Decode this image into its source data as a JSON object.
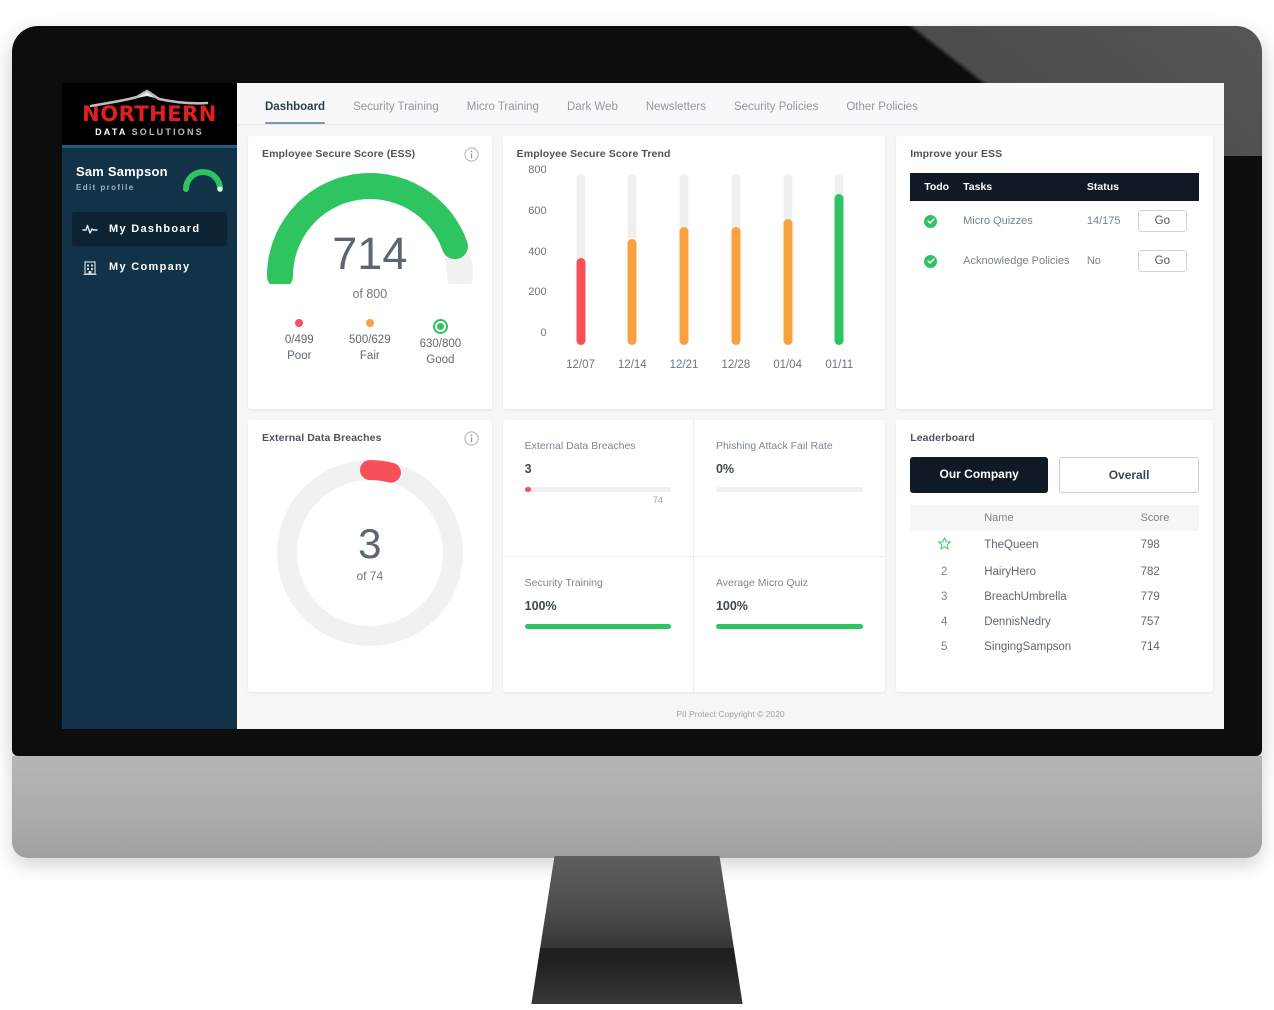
{
  "brand": {
    "name": "NORTHERN",
    "sub_data": "DATA",
    "sub_solutions": "SOLUTIONS"
  },
  "sidebar": {
    "user_name": "Sam Sampson",
    "edit_profile": "Edit profile",
    "items": [
      {
        "label": "My Dashboard",
        "icon": "pulse-icon",
        "active": true
      },
      {
        "label": "My Company",
        "icon": "building-icon",
        "active": false
      }
    ]
  },
  "tabs": [
    {
      "label": "Dashboard",
      "active": true
    },
    {
      "label": "Security Training",
      "active": false
    },
    {
      "label": "Micro Training",
      "active": false
    },
    {
      "label": "Dark Web",
      "active": false
    },
    {
      "label": "Newsletters",
      "active": false
    },
    {
      "label": "Security Policies",
      "active": false
    },
    {
      "label": "Other Policies",
      "active": false
    }
  ],
  "ess_card": {
    "title": "Employee Secure Score (ESS)",
    "value": "714",
    "of_label": "of 800",
    "legend": [
      {
        "range": "0/499",
        "label": "Poor",
        "color": "#f8505a"
      },
      {
        "range": "500/629",
        "label": "Fair",
        "color": "#f9a03f"
      },
      {
        "range": "630/800",
        "label": "Good",
        "color": "#2ec45f"
      }
    ]
  },
  "breaches_card": {
    "title": "External Data Breaches",
    "value": "3",
    "of_label": "of 74"
  },
  "improve_card": {
    "title": "Improve your ESS",
    "columns": [
      "Todo",
      "Tasks",
      "Status"
    ],
    "rows": [
      {
        "task": "Micro Quizzes",
        "status": "14/175",
        "action": "Go"
      },
      {
        "task": "Acknowledge Policies",
        "status": "No",
        "action": "Go"
      }
    ]
  },
  "metrics": [
    {
      "label": "External Data Breaches",
      "value": "3",
      "pct": 4,
      "color": "#f8505a",
      "cap": "74"
    },
    {
      "label": "Phishing Attack Fail Rate",
      "value": "0%",
      "pct": 0,
      "color": "#2ec45f",
      "cap": ""
    },
    {
      "label": "Security Training",
      "value": "100%",
      "pct": 100,
      "color": "#2ec45f",
      "cap": ""
    },
    {
      "label": "Average Micro Quiz",
      "value": "100%",
      "pct": 100,
      "color": "#2ec45f",
      "cap": ""
    }
  ],
  "leaderboard": {
    "title": "Leaderboard",
    "toggle": [
      {
        "label": "Our Company",
        "active": true
      },
      {
        "label": "Overall",
        "active": false
      }
    ],
    "columns": [
      "",
      "Name",
      "Score"
    ],
    "rows": [
      {
        "rank": "star-icon",
        "name": "TheQueen",
        "score": "798",
        "highlight": true
      },
      {
        "rank": "2",
        "name": "HairyHero",
        "score": "782",
        "highlight": false
      },
      {
        "rank": "3",
        "name": "BreachUmbrella",
        "score": "779",
        "highlight": false
      },
      {
        "rank": "4",
        "name": "DennisNedry",
        "score": "757",
        "highlight": false
      },
      {
        "rank": "5",
        "name": "SingingSampson",
        "score": "714",
        "highlight": false
      }
    ]
  },
  "footer": "PII Protect Copyright © 2020",
  "colors": {
    "red": "#f8505a",
    "orange": "#f9a03f",
    "green": "#2ec45f",
    "navy": "#123247",
    "dark": "#101a27"
  },
  "chart_data": {
    "type": "bar",
    "title": "Employee Secure Score Trend",
    "categories": [
      "12/07",
      "12/14",
      "12/21",
      "12/28",
      "01/04",
      "01/11"
    ],
    "values": [
      425,
      520,
      580,
      580,
      620,
      740
    ],
    "bar_colors": [
      "#f8505a",
      "#f9a03f",
      "#f9a03f",
      "#f9a03f",
      "#f9a03f",
      "#2ec45f"
    ],
    "track_max": 840,
    "xlabel": "",
    "ylabel": "",
    "ylim": [
      0,
      800
    ],
    "yticks": [
      0,
      200,
      400,
      600,
      800
    ],
    "grid": false,
    "legend": "none"
  }
}
